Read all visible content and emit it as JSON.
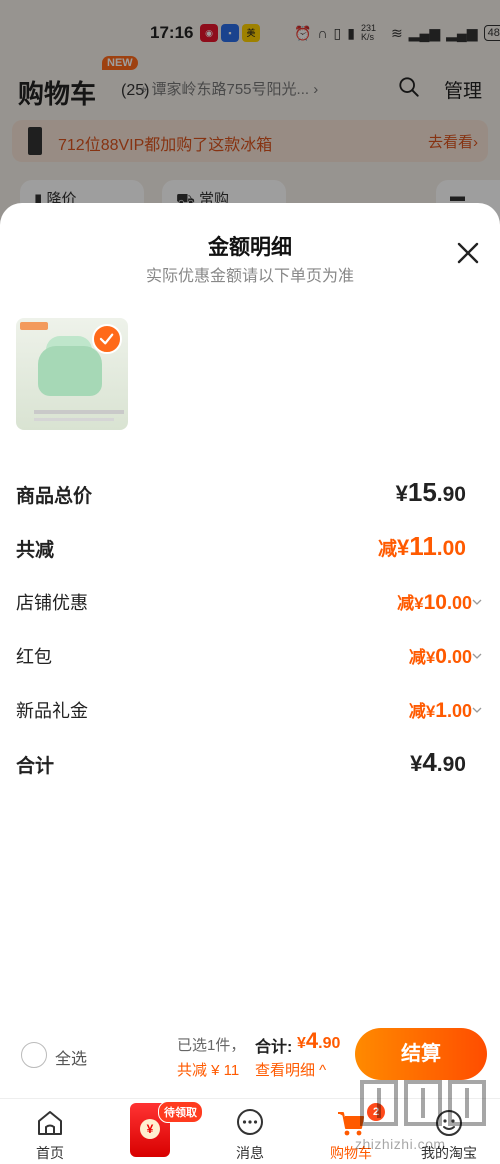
{
  "status_bar": {
    "time": "17:16",
    "speed": "231 K/s",
    "battery": "48"
  },
  "header": {
    "title": "购物车",
    "count": "(25)",
    "new_badge": "NEW",
    "address": "谭家岭东路755号阳光...",
    "manage": "管理"
  },
  "promo": {
    "text": "712位88VIP都加购了这款冰箱",
    "link": "去看看"
  },
  "bg_tabs": [
    "降价",
    "常购"
  ],
  "sheet": {
    "title": "金额明细",
    "subtitle": "实际优惠金额请以下单页为准",
    "rows": [
      {
        "label": "商品总价",
        "prefix": "",
        "currency": "¥",
        "int": "15",
        "dec": ".90"
      },
      {
        "label": "共减",
        "prefix": "减",
        "currency": "¥",
        "int": "11",
        "dec": ".00"
      },
      {
        "label": "店铺优惠",
        "prefix": "减",
        "currency": "¥",
        "int": "10",
        "dec": ".00"
      },
      {
        "label": "红包",
        "prefix": "减",
        "currency": "¥",
        "int": "0",
        "dec": ".00"
      },
      {
        "label": "新品礼金",
        "prefix": "减",
        "currency": "¥",
        "int": "1",
        "dec": ".00"
      },
      {
        "label": "合计",
        "prefix": "",
        "currency": "¥",
        "int": "4",
        "dec": ".90"
      }
    ]
  },
  "bottom": {
    "select_all": "全选",
    "selected": "已选1件，",
    "total_label": "合计:",
    "total_currency": "¥",
    "total_int": "4",
    "total_dec": ".90",
    "discount": "共减 ¥ 11",
    "detail_link": "查看明细 ^",
    "checkout": "结算"
  },
  "tabbar": {
    "home": "首页",
    "redpacket_badge": "待领取",
    "redpacket_coin": "¥",
    "messages": "消息",
    "cart": "购物车",
    "cart_badge": "2",
    "mine": "我的淘宝"
  },
  "watermark": "zhizhizhi.com",
  "colors": {
    "accent": "#ff5a00",
    "checkout_start": "#ff8a00",
    "checkout_end": "#ff4d00"
  }
}
